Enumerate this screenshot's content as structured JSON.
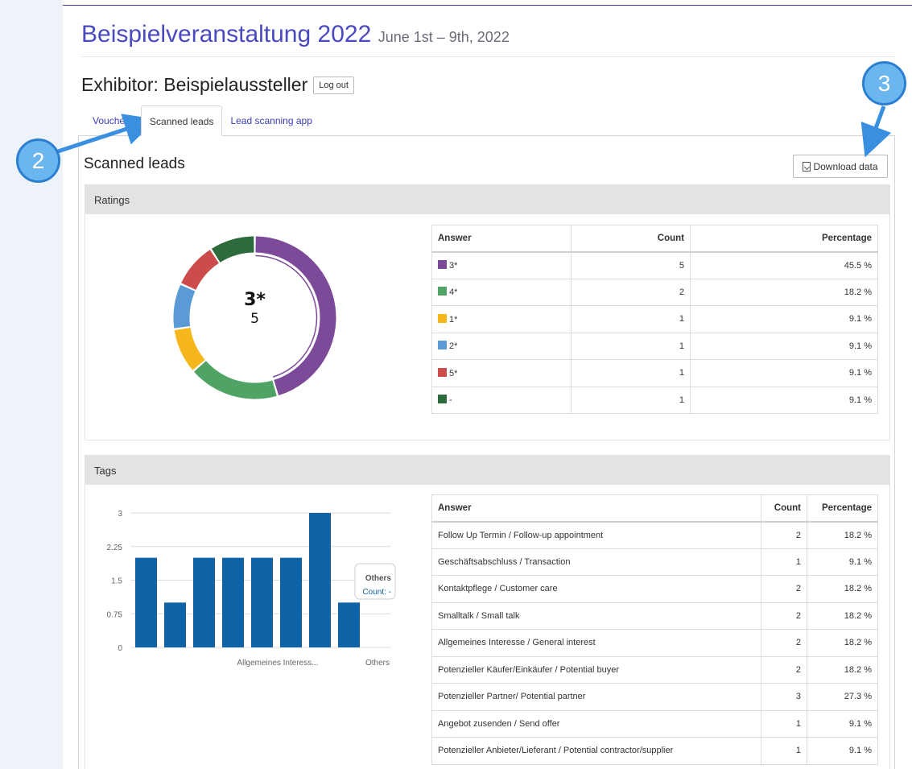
{
  "event": {
    "title": "Beispielveranstaltung 2022",
    "date": "June 1st – 9th, 2022"
  },
  "exhibitor": {
    "label": "Exhibitor: Beispielaussteller",
    "logout_label": "Log out"
  },
  "tabs": [
    {
      "label": "Vouchers"
    },
    {
      "label": "Scanned leads"
    },
    {
      "label": "Lead scanning app"
    }
  ],
  "active_tab": "Scanned leads",
  "section": {
    "title": "Scanned leads",
    "download_label": "Download data"
  },
  "ratings": {
    "title": "Ratings",
    "center_label": "3*",
    "center_value": "5",
    "columns": [
      "Answer",
      "Count",
      "Percentage"
    ],
    "rows": [
      {
        "answer": "3*",
        "count": "5",
        "percentage": "45.5 %",
        "color": "#7d4a9a"
      },
      {
        "answer": "4*",
        "count": "2",
        "percentage": "18.2 %",
        "color": "#4ea365"
      },
      {
        "answer": "1*",
        "count": "1",
        "percentage": "9.1 %",
        "color": "#f5b71c"
      },
      {
        "answer": "2*",
        "count": "1",
        "percentage": "9.1 %",
        "color": "#5b9bd5"
      },
      {
        "answer": "5*",
        "count": "1",
        "percentage": "9.1 %",
        "color": "#cc4b4b"
      },
      {
        "answer": "-",
        "count": "1",
        "percentage": "9.1 %",
        "color": "#2d6b3c"
      }
    ]
  },
  "tags": {
    "title": "Tags",
    "columns": [
      "Answer",
      "Count",
      "Percentage"
    ],
    "rows": [
      {
        "answer": "Follow Up Termin / Follow-up appointment",
        "count": "2",
        "percentage": "18.2 %"
      },
      {
        "answer": "Geschäftsabschluss / Transaction",
        "count": "1",
        "percentage": "9.1 %"
      },
      {
        "answer": "Kontaktpflege / Customer care",
        "count": "2",
        "percentage": "18.2 %"
      },
      {
        "answer": "Smalltalk / Small talk",
        "count": "2",
        "percentage": "18.2 %"
      },
      {
        "answer": "Allgemeines Interesse / General interest",
        "count": "2",
        "percentage": "18.2 %"
      },
      {
        "answer": "Potenzieller Käufer/Einkäufer / Potential buyer",
        "count": "2",
        "percentage": "18.2 %"
      },
      {
        "answer": "Potenzieller Partner/ Potential partner",
        "count": "3",
        "percentage": "27.3 %"
      },
      {
        "answer": "Angebot zusenden / Send offer",
        "count": "1",
        "percentage": "9.1 %"
      },
      {
        "answer": "Potenzieller Anbieter/Lieferant / Potential contractor/supplier",
        "count": "1",
        "percentage": "9.1 %"
      }
    ]
  },
  "tooltip": {
    "title": "Others",
    "value": "Count: -"
  },
  "annotations": {
    "two": "2",
    "three": "3"
  },
  "colors": {
    "accent": "#4a4ac0",
    "bar": "#0d63a6",
    "annotation": "#6cb6f0"
  },
  "chart_data": [
    {
      "type": "pie",
      "categories": [
        "3*",
        "4*",
        "1*",
        "2*",
        "5*",
        "-"
      ],
      "values": [
        5,
        2,
        1,
        1,
        1,
        1
      ]
    },
    {
      "type": "bar",
      "values": [
        2,
        1,
        2,
        2,
        2,
        2,
        3,
        1
      ],
      "ytick_labels": [
        "0",
        "0.75",
        "1.5",
        "2.25",
        "3"
      ],
      "xtick_labels": [
        "Allgemeines Interess...",
        "Others"
      ],
      "ylim": [
        0,
        3
      ],
      "color": "#0d63a6"
    }
  ]
}
